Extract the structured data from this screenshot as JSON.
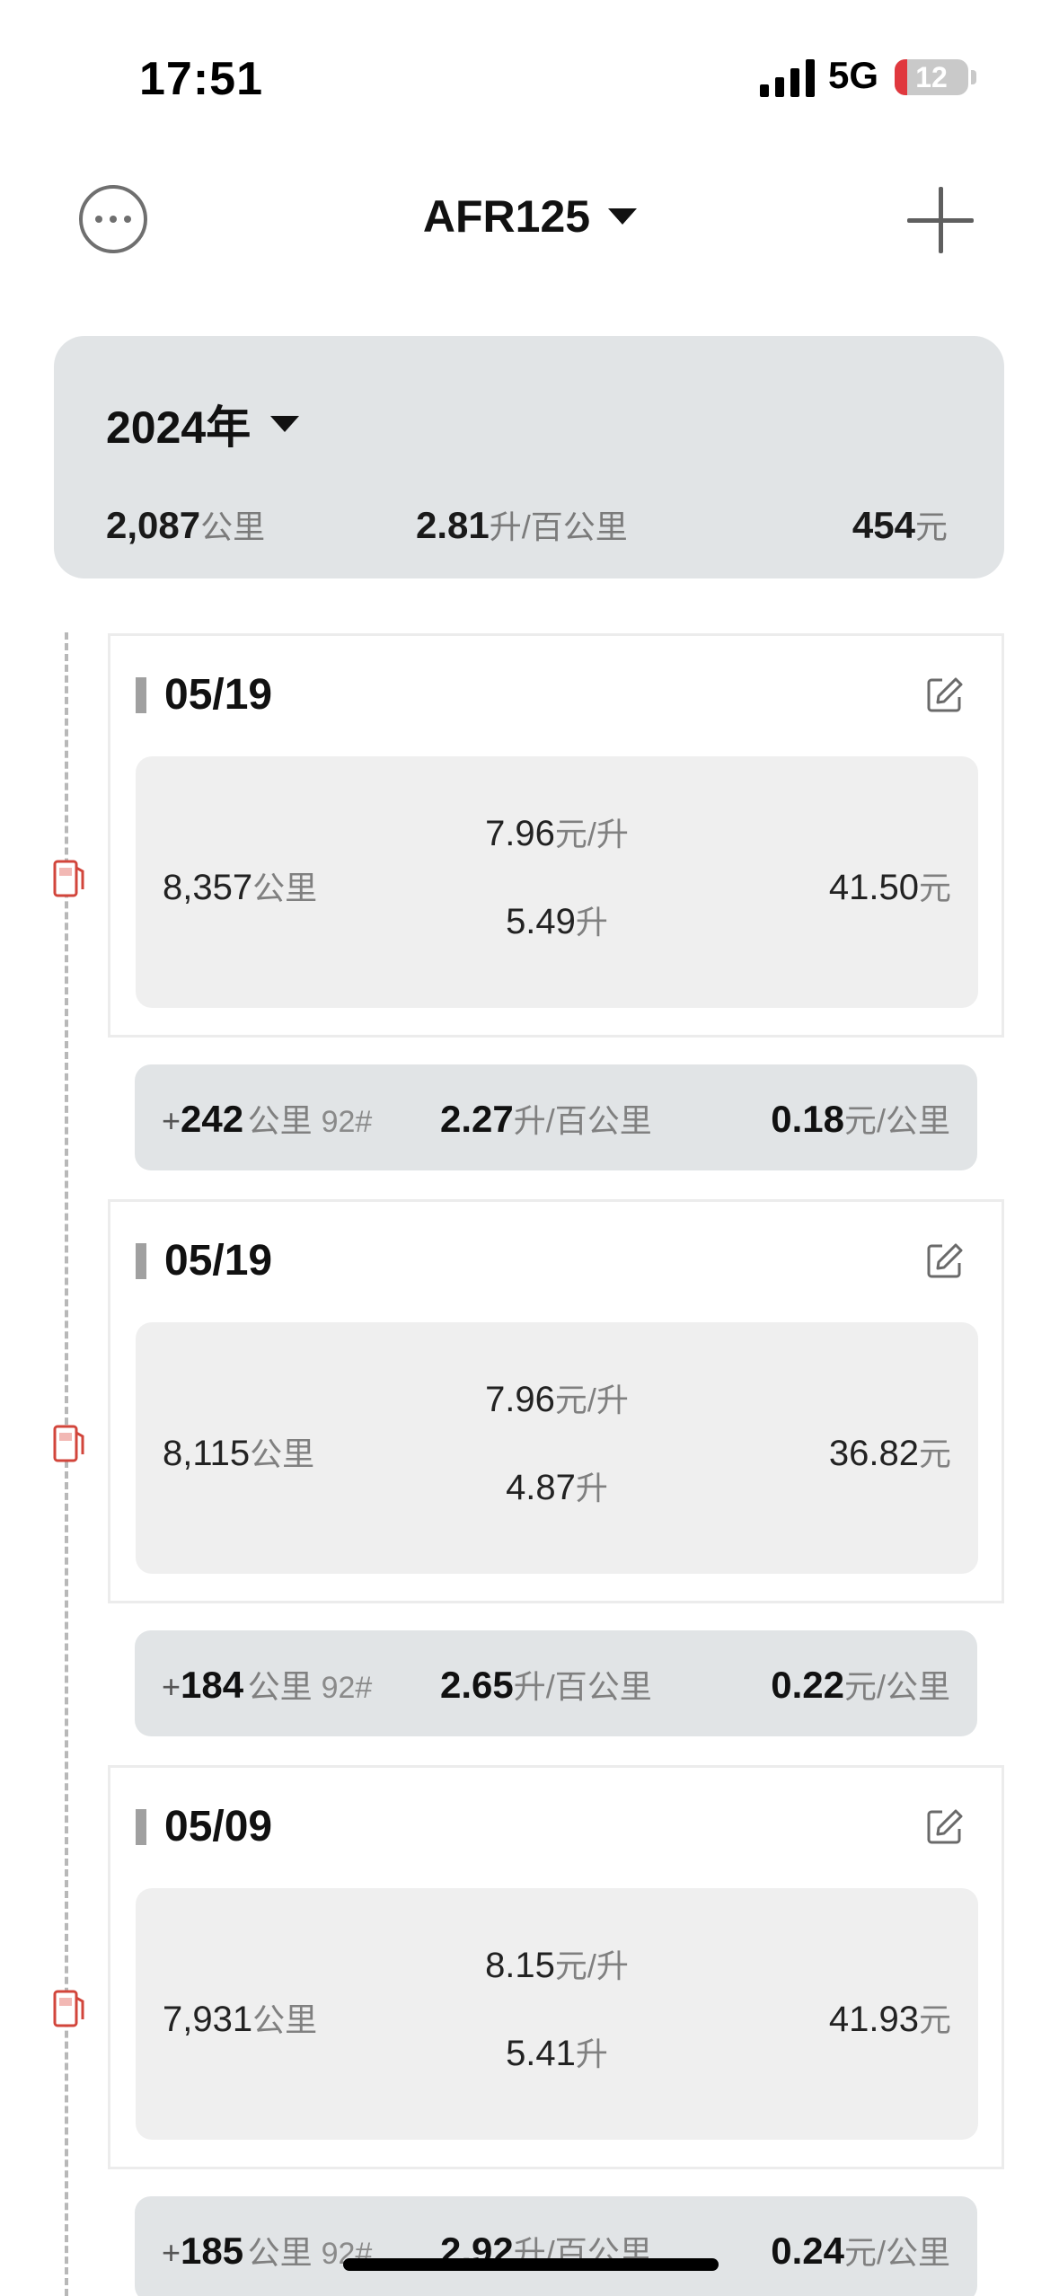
{
  "status": {
    "time": "17:51",
    "network": "5G",
    "battery": "12"
  },
  "nav": {
    "title": "AFR125"
  },
  "summary": {
    "year": "2024年",
    "distance": "2,087",
    "distance_unit": "公里",
    "consumption": "2.81",
    "consumption_unit": "升/百公里",
    "cost": "454",
    "cost_unit": "元"
  },
  "records": [
    {
      "date": "05/19",
      "odometer": "8,357",
      "odometer_unit": "公里",
      "price": "7.96",
      "price_unit": "元/升",
      "liters": "5.49",
      "liters_unit": "升",
      "cost": "41.50",
      "cost_unit": "元"
    },
    {
      "date": "05/19",
      "odometer": "8,115",
      "odometer_unit": "公里",
      "price": "7.96",
      "price_unit": "元/升",
      "liters": "4.87",
      "liters_unit": "升",
      "cost": "36.82",
      "cost_unit": "元"
    },
    {
      "date": "05/09",
      "odometer": "7,931",
      "odometer_unit": "公里",
      "price": "8.15",
      "price_unit": "元/升",
      "liters": "5.41",
      "liters_unit": "升",
      "cost": "41.93",
      "cost_unit": "元"
    }
  ],
  "stats": [
    {
      "plus": "+",
      "distance": "242",
      "distance_unit": "公里",
      "fuel": "92#",
      "consumption": "2.27",
      "consumption_unit": "升/百公里",
      "cost_per_km": "0.18",
      "cost_per_km_unit": "元/公里"
    },
    {
      "plus": "+",
      "distance": "184",
      "distance_unit": "公里",
      "fuel": "92#",
      "consumption": "2.65",
      "consumption_unit": "升/百公里",
      "cost_per_km": "0.22",
      "cost_per_km_unit": "元/公里"
    },
    {
      "plus": "+",
      "distance": "185",
      "distance_unit": "公里",
      "fuel": "92#",
      "consumption": "2.92",
      "consumption_unit": "升/百公里",
      "cost_per_km": "0.24",
      "cost_per_km_unit": "元/公里"
    }
  ]
}
